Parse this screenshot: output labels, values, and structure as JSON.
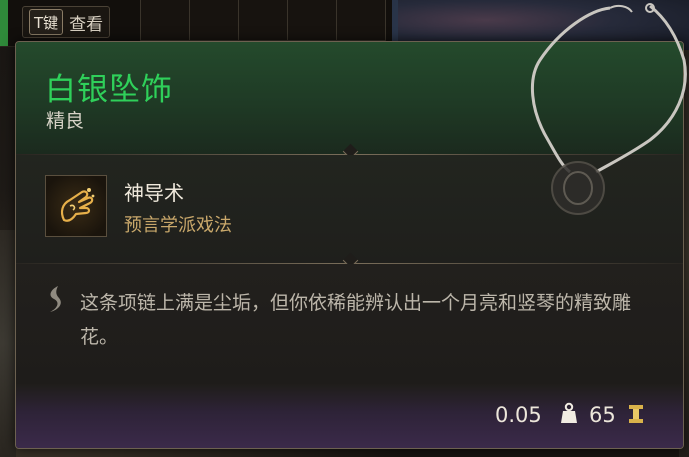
{
  "hint": {
    "key": "T键",
    "action": "查看"
  },
  "item": {
    "name": "白银坠饰",
    "rarity": "精良",
    "rarity_color": "#2fd05a"
  },
  "spell": {
    "name": "神导术",
    "school": "预言学派戏法",
    "icon": "guidance-hand-icon"
  },
  "description": {
    "icon": "quill-icon",
    "text": "这条项链上满是尘垢，但你依稀能辨认出一个月亮和竖琴的精致雕花。"
  },
  "footer": {
    "weight": "0.05",
    "weight_icon": "weight-icon",
    "price": "65",
    "price_icon": "gold-coin-icon",
    "price_color": "#d9b24a"
  }
}
